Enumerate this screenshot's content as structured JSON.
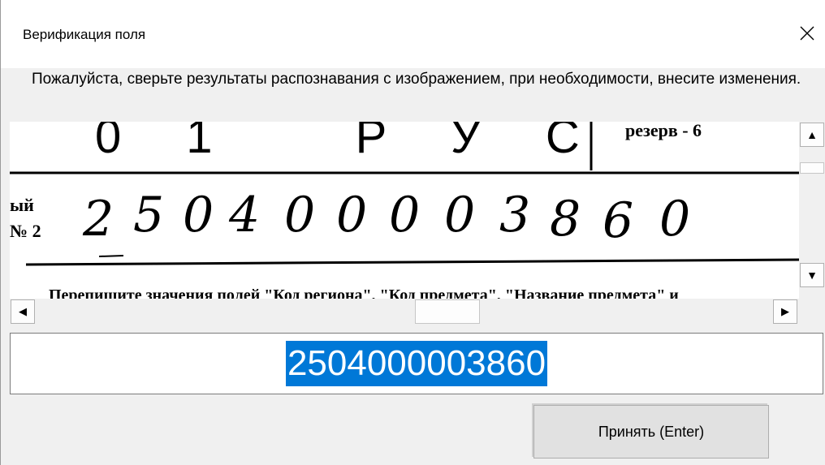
{
  "window": {
    "title": "Верификация поля",
    "close_label": "✕"
  },
  "instruction": "Пожалуйста, сверьте результаты распознавания с изображением, при необходимости, внесите изменения.",
  "image": {
    "top_row_text": "01 РУС",
    "top_right_text": "резерв - 6",
    "field_label_line1": "ый",
    "field_label_line2": "№ 2",
    "handwritten_digits": [
      "2",
      "5",
      "0",
      "4",
      "0",
      "0",
      "0",
      "0",
      "3",
      "8",
      "6",
      "0"
    ],
    "bottom_text": "Перепишите значения полей \"Код региона\", \"Код предмета\", \"Название предмета\" и"
  },
  "result": {
    "value": "2504000003860"
  },
  "accept_button": {
    "label": "Принять (Enter)"
  },
  "scrollbars": {
    "up_arrow": "▲",
    "down_arrow": "▼",
    "left_arrow": "◀",
    "right_arrow": "▶"
  }
}
